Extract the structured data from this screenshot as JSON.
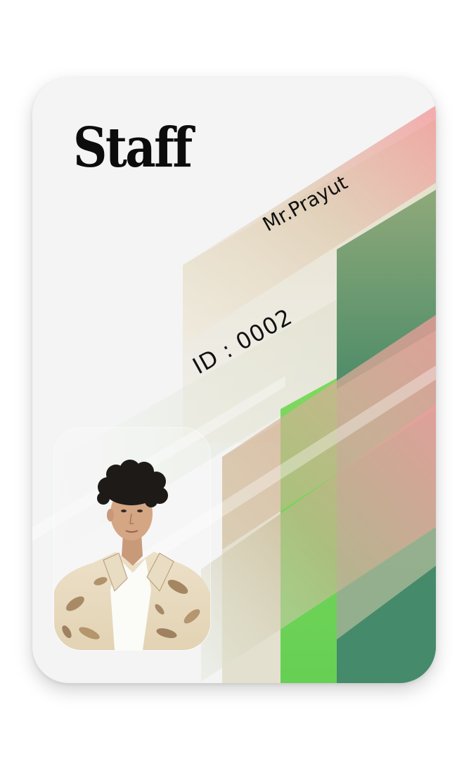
{
  "card": {
    "role_title": "Staff",
    "holder_name": "Mr.Prayut",
    "staff_id": "ID : 0002"
  },
  "photo": {
    "subject": "staff portrait",
    "outfit": "cream shirt with brown leaf print over white t-shirt"
  },
  "colors": {
    "card_background": "#f4f4f5",
    "accent_pink": "#f39a9c",
    "accent_green_dark": "#3f8a67",
    "accent_green_bright": "#6bd05a",
    "accent_beige": "#d9d2b4",
    "text": "#111111"
  }
}
